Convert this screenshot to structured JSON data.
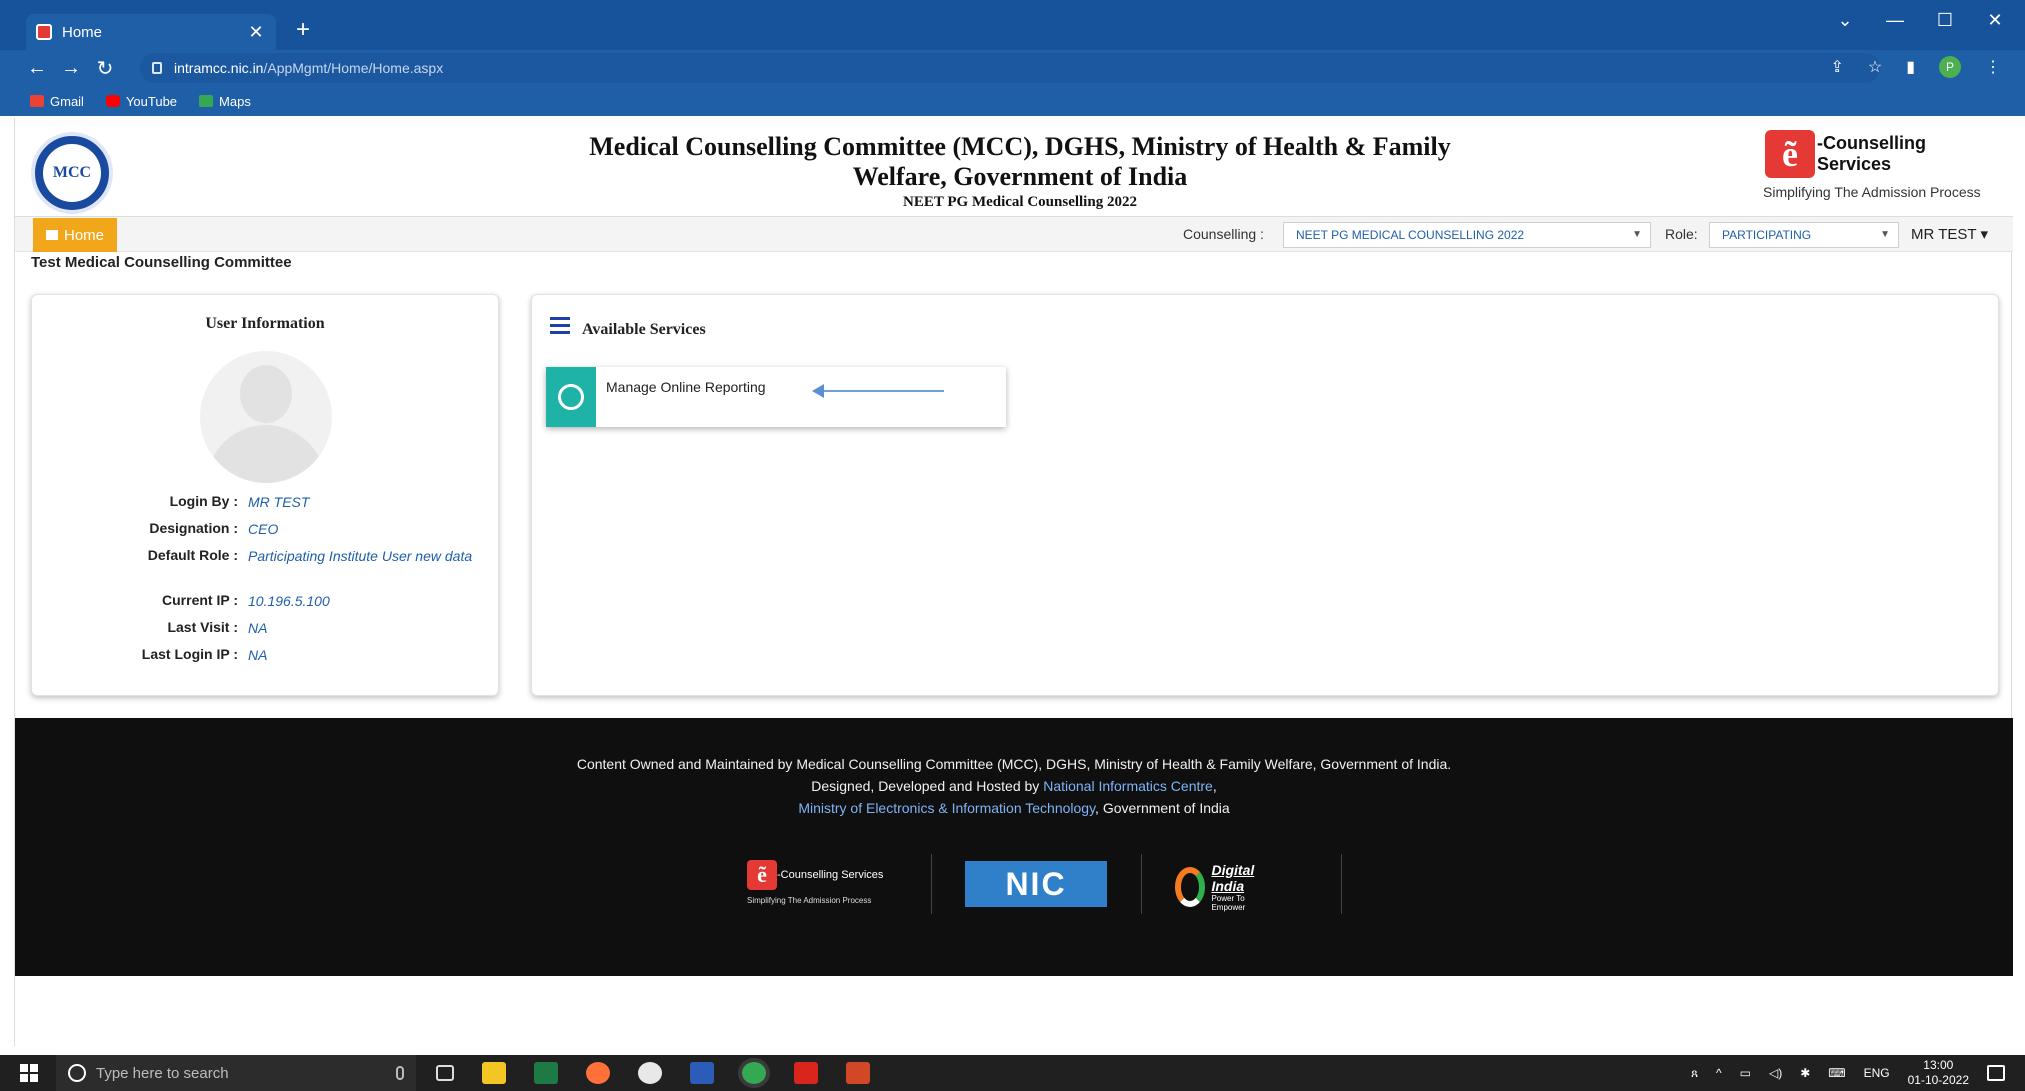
{
  "browser": {
    "tab_title": "Home",
    "tab_close": "✕",
    "new_tab": "+",
    "url_host": "intramcc.nic.in",
    "url_path": "/AppMgmt/Home/Home.aspx",
    "bookmarks": [
      {
        "label": "Gmail",
        "color": "#ea4335"
      },
      {
        "label": "YouTube",
        "color": "#ff0000"
      },
      {
        "label": "Maps",
        "color": "#34a853"
      }
    ],
    "profile_initial": "P"
  },
  "header": {
    "title": "Medical Counselling Committee (MCC), DGHS, Ministry of Health & Family Welfare, Government of India",
    "subtitle": "NEET PG Medical Counselling 2022",
    "logo_left_text": "MCC",
    "ec_badge": "ẽ",
    "ec_label": "-Counselling Services",
    "ec_tagline": "Simplifying The Admission Process"
  },
  "navbar": {
    "home_label": "Home",
    "counselling_label": "Counselling :",
    "counselling_value": "NEET PG MEDICAL COUNSELLING 2022",
    "role_label": "Role:",
    "role_value": "PARTICIPATING",
    "user_menu": "MR TEST ▾"
  },
  "org_name": "Test Medical Counselling Committee",
  "user_info": {
    "title": "User Information",
    "rows": [
      {
        "key": "Login By :",
        "value": "MR TEST"
      },
      {
        "key": "Designation :",
        "value": "CEO"
      },
      {
        "key": "Default Role :",
        "value": "Participating Institute User new data"
      },
      {
        "key": "Current IP :",
        "value": "10.196.5.100"
      },
      {
        "key": "Last Visit :",
        "value": "NA"
      },
      {
        "key": "Last Login IP :",
        "value": "NA"
      }
    ]
  },
  "services": {
    "title": "Available Services",
    "items": [
      {
        "label": "Manage Online Reporting"
      }
    ]
  },
  "footer": {
    "line1": "Content Owned and Maintained by Medical Counselling Committee (MCC), DGHS, Ministry of Health & Family Welfare, Government of India.",
    "line2_prefix": "Designed, Developed and Hosted by ",
    "line2_link": "National Informatics Centre",
    "line2_suffix": ",",
    "line3_link": "Ministry of Electronics & Information Technology",
    "line3_suffix": ", Government of India",
    "logo_ec_label": "-Counselling Services",
    "logo_ec_tagline": "Simplifying The Admission Process",
    "logo_nic": "NIC",
    "logo_di_title": "Digital India",
    "logo_di_tagline": "Power To Empower"
  },
  "taskbar": {
    "search_placeholder": "Type here to search",
    "language": "ENG",
    "time": "13:00",
    "date": "01-10-2022"
  },
  "colors": {
    "browser_blue": "#1f5fa8",
    "home_orange": "#f2a71b",
    "service_teal": "#1fb2a6",
    "link_blue": "#1f5fa8"
  }
}
